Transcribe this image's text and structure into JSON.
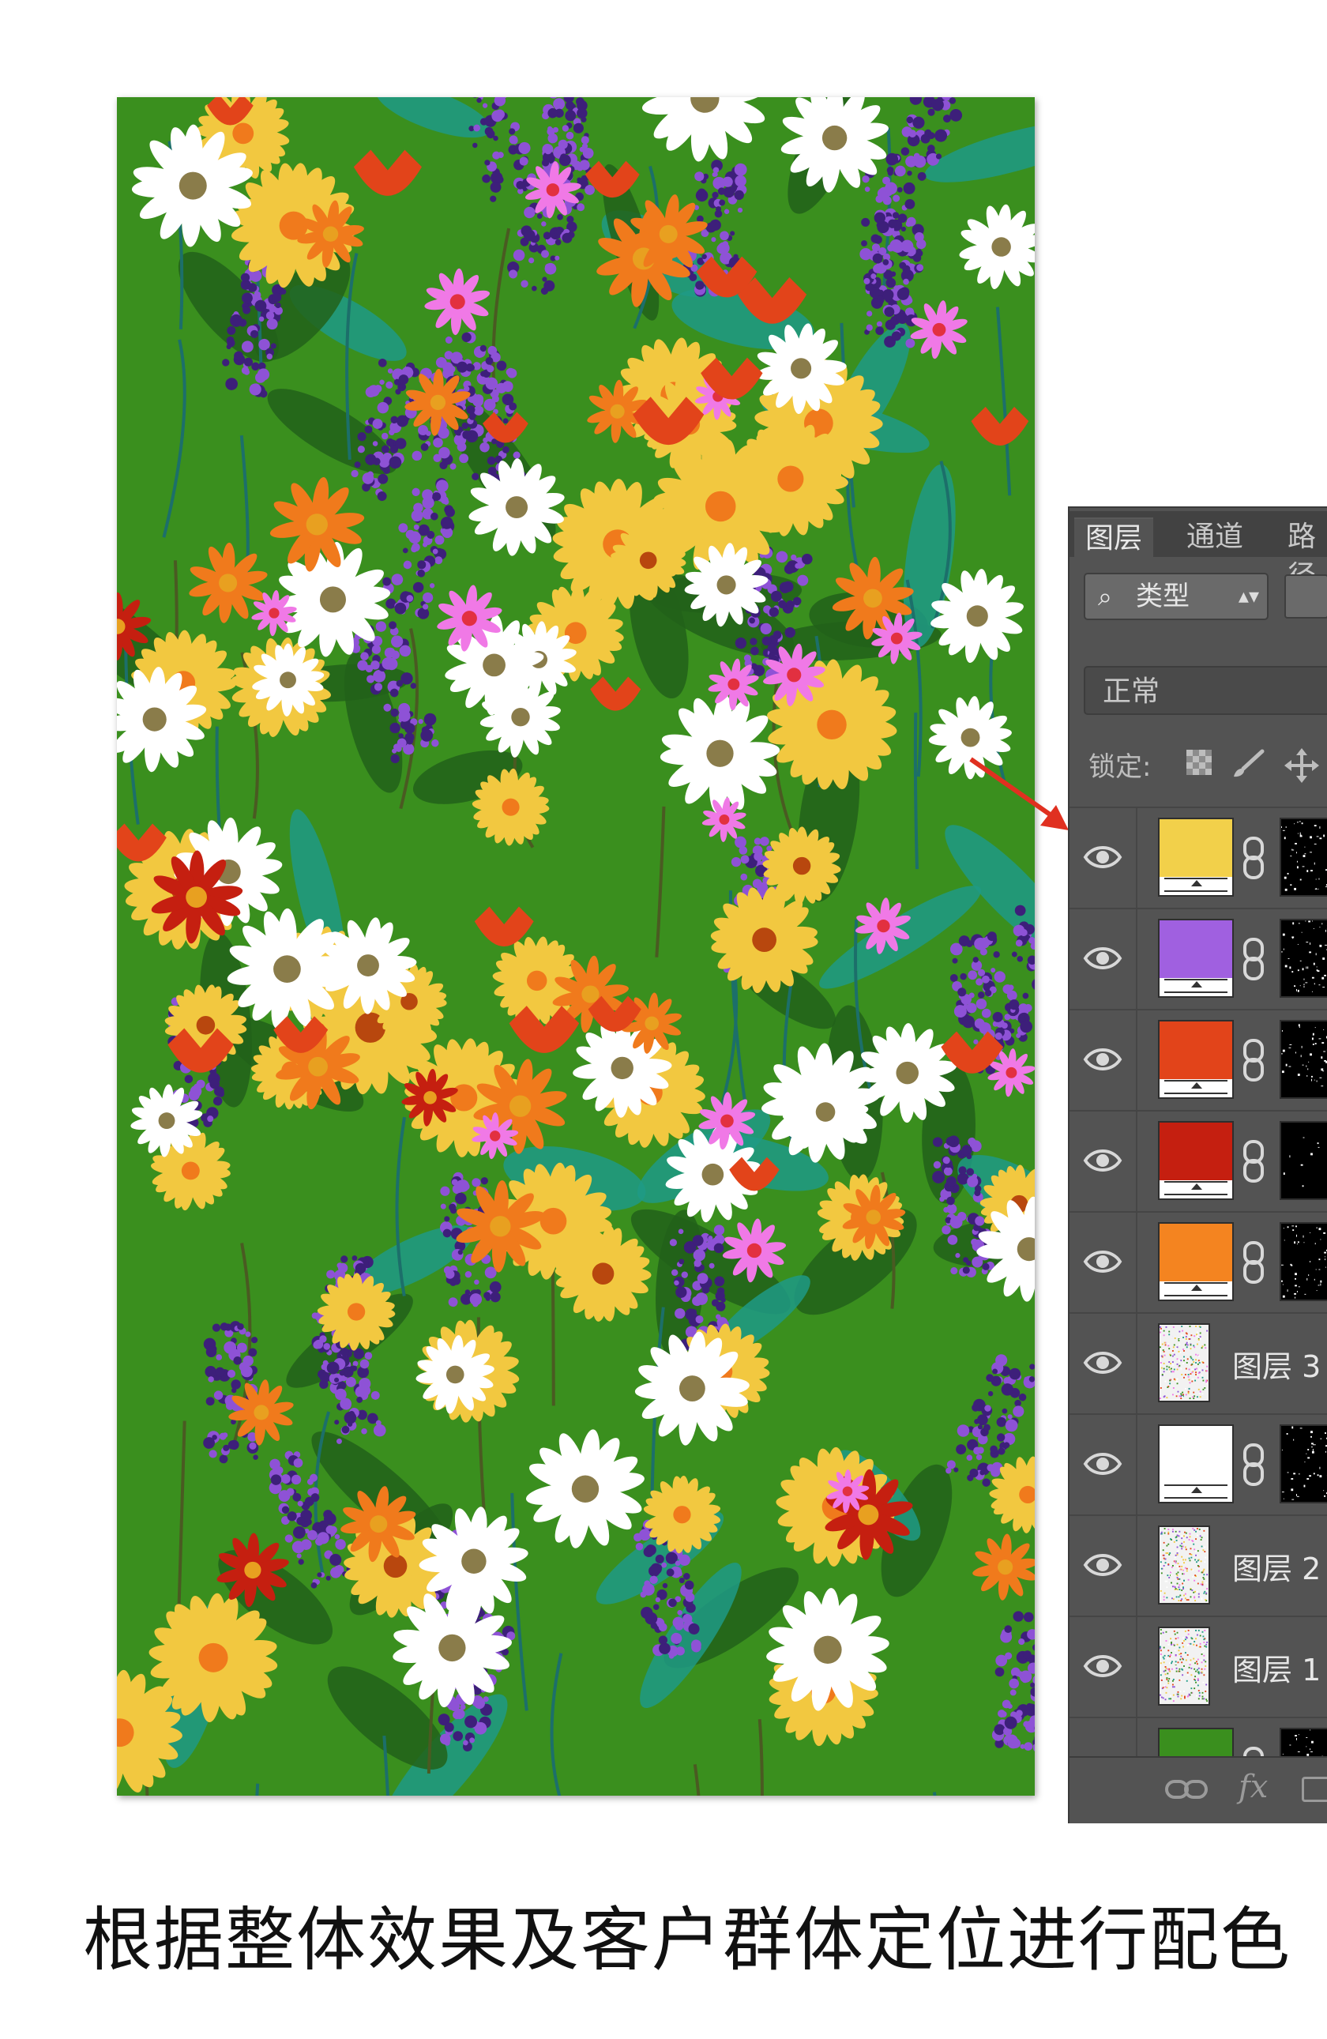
{
  "caption": "根据整体效果及客户群体定位进行配色",
  "artwork": {
    "background_color": "#3a8f1e",
    "palette": {
      "yellow": "#f2c840",
      "purple": "#8e52d6",
      "dark_purple": "#3d1f7a",
      "orange_red": "#e2441a",
      "red": "#c51f10",
      "orange": "#f07a1c",
      "white": "#ffffff",
      "pink": "#f079e6",
      "teal": "#1f9a86",
      "dark_green": "#22621a"
    }
  },
  "layers_panel": {
    "tabs": [
      "图层",
      "通道",
      "路径"
    ],
    "filter": {
      "label": "类型",
      "search_icon": "search-icon"
    },
    "blend_mode": "正常",
    "lock_label": "锁定:",
    "layers": [
      {
        "type": "fill",
        "color": "#f2d04a"
      },
      {
        "type": "fill",
        "color": "#a060e0"
      },
      {
        "type": "fill",
        "color": "#e2441a"
      },
      {
        "type": "fill",
        "color": "#c51f10"
      },
      {
        "type": "fill",
        "color": "#f48420"
      },
      {
        "type": "pixel",
        "name": "图层 3"
      },
      {
        "type": "fill",
        "color": "#ffffff"
      },
      {
        "type": "pixel",
        "name": "图层 2"
      },
      {
        "type": "pixel",
        "name": "图层 1"
      },
      {
        "type": "fill",
        "color": "#3a8f1e"
      }
    ],
    "bottom_icons": [
      "link-icon",
      "fx-icon",
      "mask-icon"
    ],
    "fx_label": "fx"
  }
}
